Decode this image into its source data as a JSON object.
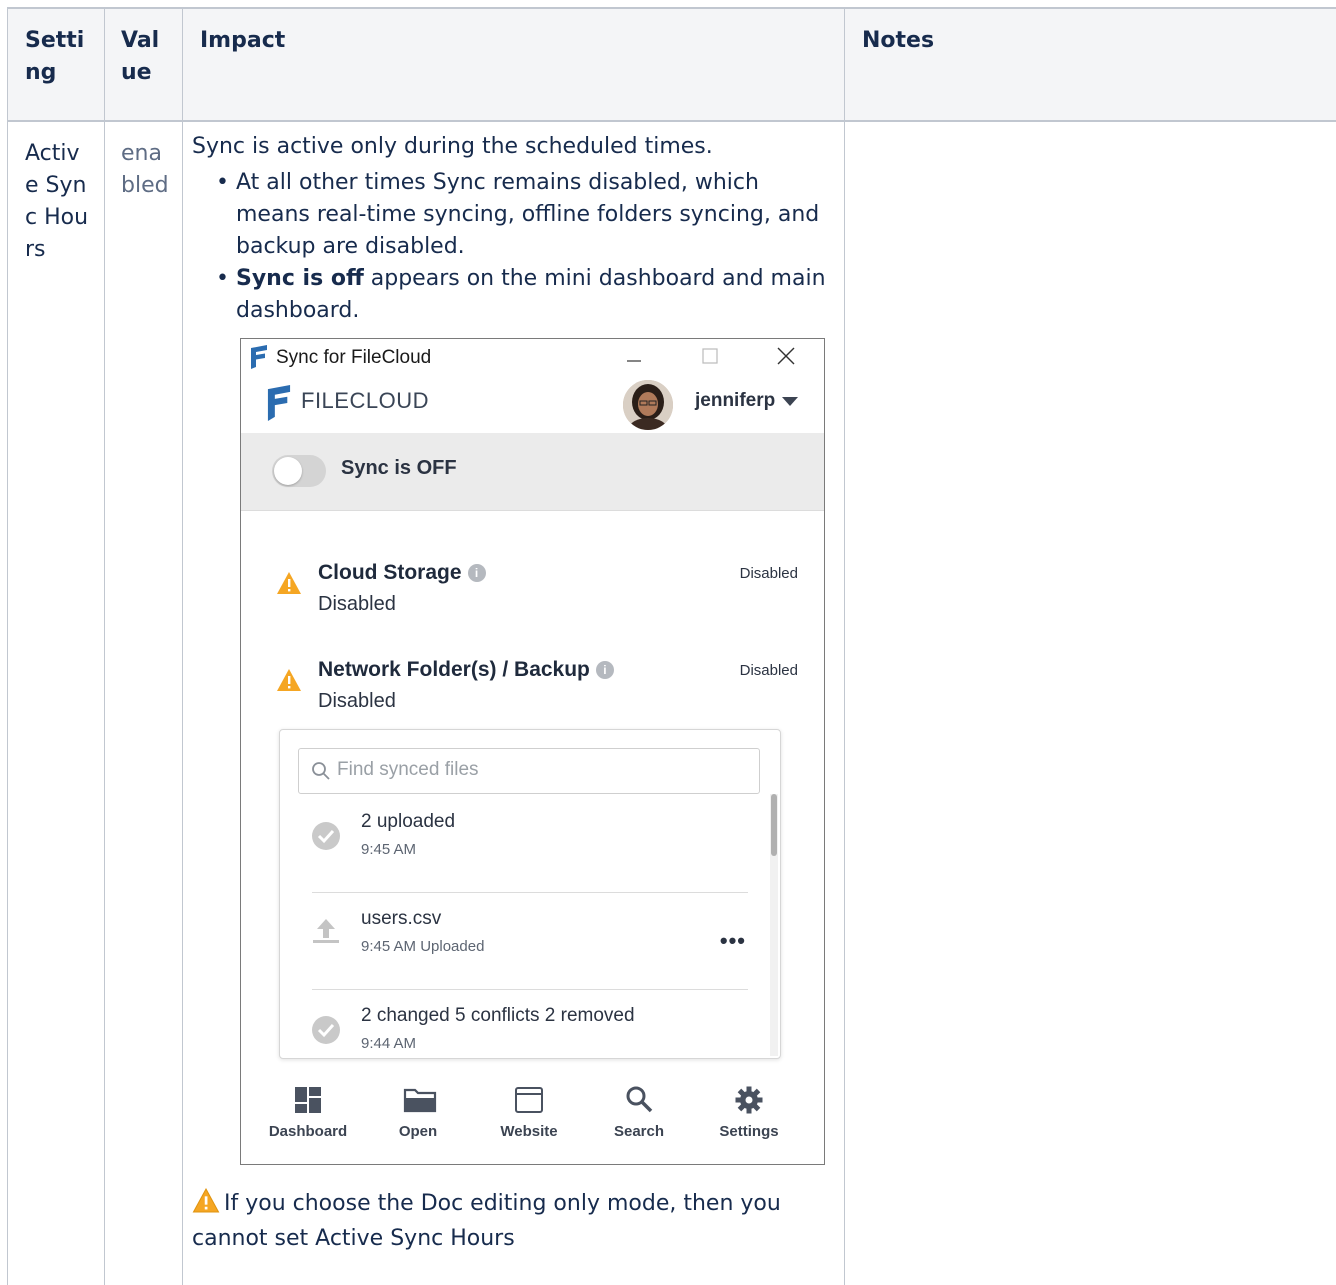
{
  "table": {
    "headers": [
      "Setting",
      "Value",
      "Impact",
      "Notes"
    ],
    "row": {
      "setting": "Active Sync Hours",
      "value": "enabled",
      "impact_intro": "Sync is active only during the scheduled times.",
      "bullets": [
        {
          "bold": "",
          "text": "At all other times Sync remains disabled, which means real-time syncing, offline folders syncing, and backup are disabled."
        },
        {
          "bold": "Sync is off",
          "text": " appears on the mini dashboard and main dashboard."
        }
      ],
      "warning_note": "If you choose the Doc editing only mode, then you cannot set Active Sync Hours",
      "notes": ""
    }
  },
  "sync_window": {
    "title": "Sync for FileCloud",
    "brand": "FILECLOUD",
    "username": "jenniferp",
    "sync_status_label": "Sync is OFF",
    "sections": [
      {
        "title": "Cloud Storage",
        "subtitle": "Disabled",
        "status": "Disabled"
      },
      {
        "title": "Network Folder(s) / Backup",
        "subtitle": "Disabled",
        "status": "Disabled"
      }
    ],
    "search_placeholder": "Find synced files",
    "activity": [
      {
        "title": "2 uploaded",
        "subtitle": "9:45 AM",
        "icon": "check-circle-icon"
      },
      {
        "title": "users.csv",
        "subtitle": "9:45 AM Uploaded",
        "icon": "upload-icon",
        "more": "•••"
      },
      {
        "title": "2 changed 5 conflicts 2 removed",
        "subtitle": "9:44 AM",
        "icon": "check-circle-icon"
      }
    ],
    "nav": [
      {
        "label": "Dashboard",
        "icon": "dashboard-icon"
      },
      {
        "label": "Open",
        "icon": "folder-icon"
      },
      {
        "label": "Website",
        "icon": "browser-window-icon"
      },
      {
        "label": "Search",
        "icon": "search-icon"
      },
      {
        "label": "Settings",
        "icon": "gear-icon"
      }
    ]
  },
  "colors": {
    "header_bg": "#f4f5f7",
    "border": "#c1c7d0",
    "text": "#172b4d",
    "warning_orange": "#f5a623",
    "filecloud_blue": "#2b6cb0"
  }
}
